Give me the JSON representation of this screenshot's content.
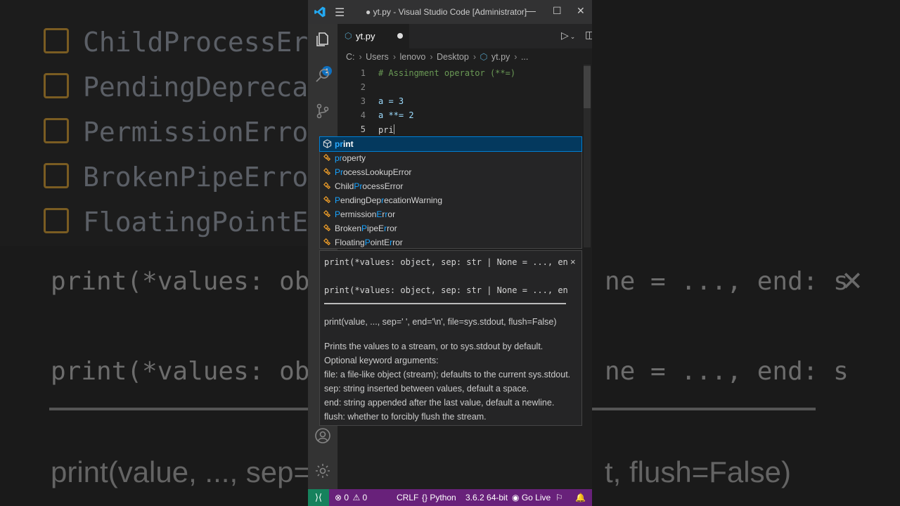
{
  "window": {
    "title": "● yt.py - Visual Studio Code [Administrator]",
    "minimize": "—",
    "maximize": "☐",
    "close": "✕"
  },
  "activity_bar": {
    "explorer_badge": "1"
  },
  "tab": {
    "label": "yt.py",
    "icon": "python-icon"
  },
  "breadcrumb": [
    "C:",
    "Users",
    "lenovo",
    "Desktop",
    "yt.py",
    "..."
  ],
  "editor": {
    "line_numbers": [
      "1",
      "2",
      "3",
      "4",
      "5"
    ],
    "lines": [
      "# Assingment operator (**=)",
      "",
      "a = 3",
      "a **= 2",
      "pri"
    ]
  },
  "suggestions": [
    {
      "label": "print",
      "kind": "function"
    },
    {
      "label": "property",
      "kind": "class"
    },
    {
      "label": "ProcessLookupError",
      "kind": "class"
    },
    {
      "label": "ChildProcessError",
      "kind": "class"
    },
    {
      "label": "PendingDeprecationWarning",
      "kind": "class"
    },
    {
      "label": "PermissionError",
      "kind": "class"
    },
    {
      "label": "BrokenPipeError",
      "kind": "class"
    },
    {
      "label": "FloatingPointError",
      "kind": "class"
    }
  ],
  "docs": {
    "signature_1": "print(*values: object, sep: str | None = ..., end: s",
    "signature_2": "print(*values: object, sep: str | None = ..., end: s",
    "call": "print(value, ..., sep=' ', end='\\n', file=sys.stdout, flush=False)",
    "description": [
      "Prints the values to a stream, or to sys.stdout by default.",
      "Optional keyword arguments:",
      "file: a file-like object (stream); defaults to the current sys.stdout.",
      "sep: string inserted between values, default a space.",
      "end: string appended after the last value, default a newline.",
      "flush: whether to forcibly flush the stream."
    ],
    "close": "×"
  },
  "statusbar": {
    "errors": "0",
    "warnings": "0",
    "eol": "CRLF",
    "language": "Python",
    "interpreter": "3.6.2 64-bit",
    "golive": "Go Live"
  },
  "background": {
    "suggestions": [
      "ChildProcessErro",
      "PendingDeprecat",
      "PermissionError",
      "BrokenPipeError",
      "FloatingPointEr"
    ],
    "sig_left": "print(*values: obj",
    "sig_right": "ne = ...,  end: s",
    "doc_left": "print(value, ..., sep=' ',",
    "doc_right": "t, flush=False)"
  },
  "colors": {
    "accent": "#007acc",
    "statusbar": "#68217a",
    "remote": "#16825d",
    "match": "#18a3ff"
  }
}
